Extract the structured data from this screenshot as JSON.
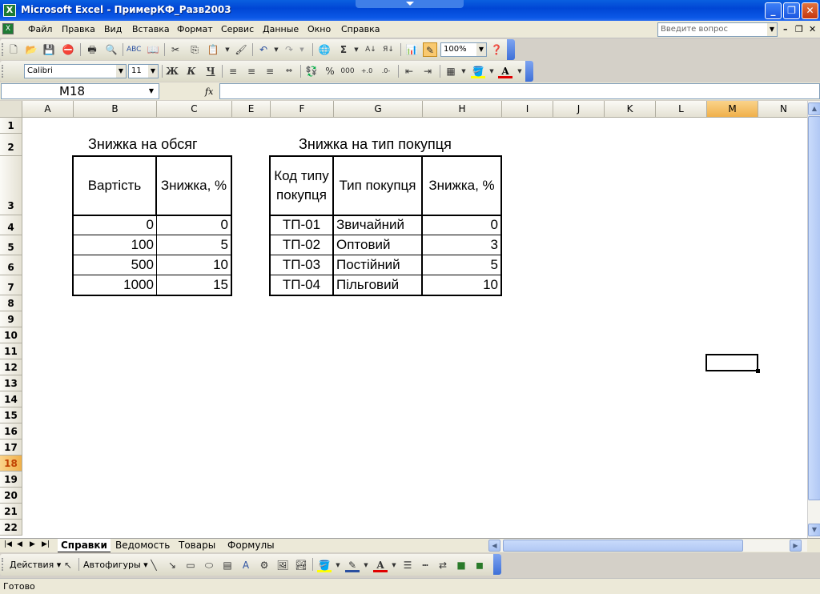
{
  "window": {
    "title": "Microsoft Excel - ПримерКФ_Разв2003",
    "buttons": {
      "minimize": "_",
      "restore": "❐",
      "close": "✕"
    }
  },
  "menu": {
    "items": [
      "Файл",
      "Правка",
      "Вид",
      "Вставка",
      "Формат",
      "Сервис",
      "Данные",
      "Окно",
      "Справка"
    ],
    "ask_placeholder": "Введите вопрос"
  },
  "toolbar": {
    "zoom": "100%",
    "font_name": "Calibri",
    "font_size": "11",
    "bold": "Ж",
    "italic": "К",
    "underline": "Ч",
    "percent": "%",
    "thousands": "000"
  },
  "formula_bar": {
    "name_box": "M18",
    "fx": "fx",
    "content": ""
  },
  "grid": {
    "columns": [
      "A",
      "B",
      "C",
      "E",
      "F",
      "G",
      "H",
      "I",
      "J",
      "K",
      "L",
      "M",
      "N"
    ],
    "rows": [
      "1",
      "2",
      "3",
      "4",
      "5",
      "6",
      "7",
      "8",
      "9",
      "10",
      "11",
      "12",
      "13",
      "14",
      "15",
      "16",
      "17",
      "18",
      "19",
      "20",
      "21",
      "22"
    ],
    "selected_column": "M",
    "selected_row": "18"
  },
  "sheet": {
    "volume_title": "Знижка на обсяг",
    "volume_header": [
      "Вартість",
      "Знижка, %"
    ],
    "volume_rows": [
      [
        "0",
        "0"
      ],
      [
        "100",
        "5"
      ],
      [
        "500",
        "10"
      ],
      [
        "1000",
        "15"
      ]
    ],
    "buyer_title": "Знижка на тип покупця",
    "buyer_header": [
      "Код типу покупця",
      "Тип покупця",
      "Знижка, %"
    ],
    "buyer_rows": [
      [
        "ТП-01",
        "Звичайний",
        "0"
      ],
      [
        "ТП-02",
        "Оптовий",
        "3"
      ],
      [
        "ТП-03",
        "Постійний",
        "5"
      ],
      [
        "ТП-04",
        "Пільговий",
        "10"
      ]
    ]
  },
  "tabs": [
    "Справки",
    "Ведомость",
    "Товары",
    "Формулы"
  ],
  "drawing_toolbar": {
    "actions": "Действия",
    "autoshapes": "Автофигуры"
  },
  "status": "Готово"
}
